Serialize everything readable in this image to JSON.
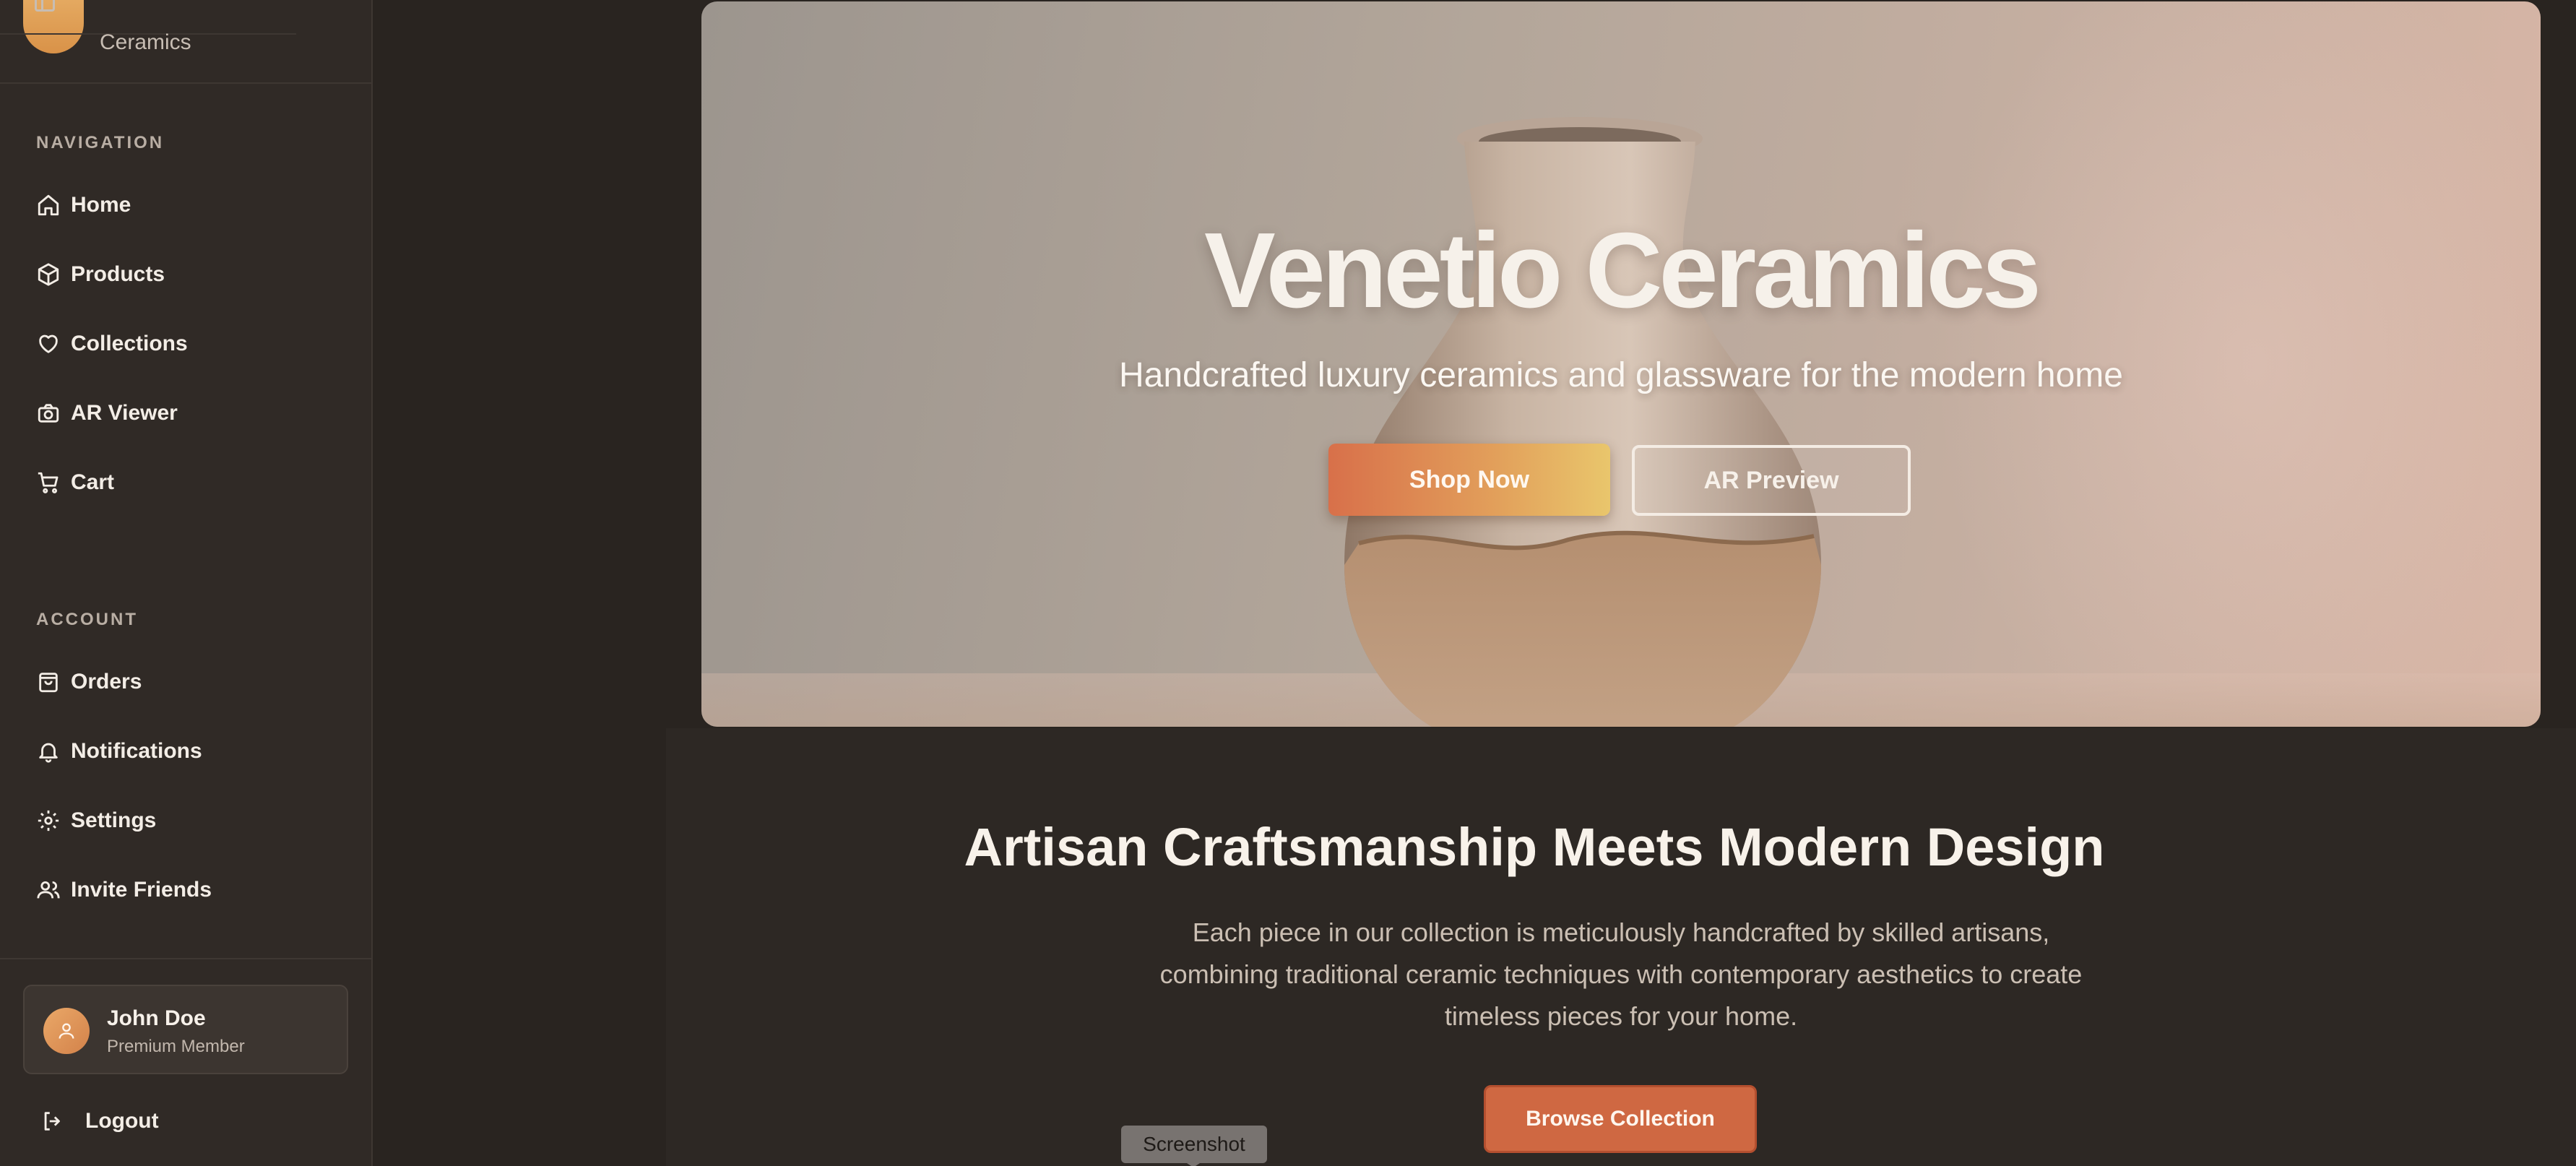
{
  "sidebar": {
    "brand": {
      "name": "Ceramics"
    },
    "navigation": {
      "title": "NAVIGATION",
      "items": [
        {
          "label": "Home",
          "icon": "home-icon"
        },
        {
          "label": "Products",
          "icon": "package-icon"
        },
        {
          "label": "Collections",
          "icon": "heart-icon"
        },
        {
          "label": "AR Viewer",
          "icon": "camera-icon"
        },
        {
          "label": "Cart",
          "icon": "cart-icon"
        }
      ]
    },
    "account": {
      "title": "ACCOUNT",
      "items": [
        {
          "label": "Orders",
          "icon": "shopping-bag-icon"
        },
        {
          "label": "Notifications",
          "icon": "bell-icon"
        },
        {
          "label": "Settings",
          "icon": "gear-icon"
        },
        {
          "label": "Invite Friends",
          "icon": "users-icon"
        }
      ]
    },
    "user": {
      "name": "John Doe",
      "role": "Premium Member"
    },
    "logout_label": "Logout"
  },
  "hero": {
    "title": "Venetio Ceramics",
    "subtitle": "Handcrafted luxury ceramics and glassware for the modern home",
    "primary_button": "Shop Now",
    "secondary_button": "AR Preview"
  },
  "intro": {
    "heading": "Artisan Craftsmanship Meets Modern Design",
    "body": "Each piece in our collection is meticulously handcrafted by skilled artisans, combining traditional ceramic techniques with contemporary aesthetics to create timeless pieces for your home.",
    "button": "Browse Collection"
  },
  "tooltip": {
    "text": "Screenshot"
  },
  "colors": {
    "background": "#292420",
    "sidebar": "#302a26",
    "accent": "#cf6842",
    "accent_gradient_end": "#e9c66c"
  }
}
